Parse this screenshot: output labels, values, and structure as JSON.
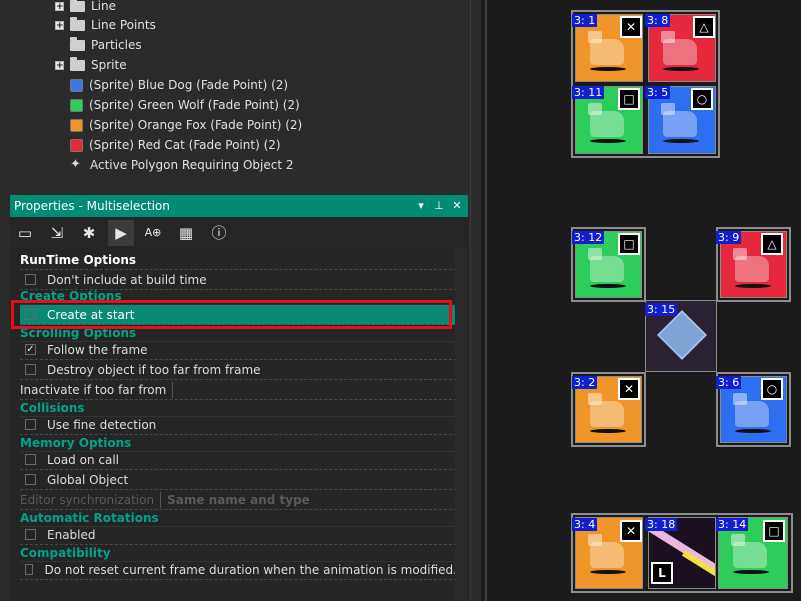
{
  "tree": {
    "items": [
      {
        "label": "Line",
        "type": "folder",
        "expandable": true
      },
      {
        "label": "Line Points",
        "type": "folder",
        "expandable": true
      },
      {
        "label": "Particles",
        "type": "folder",
        "expandable": false
      },
      {
        "label": "Sprite",
        "type": "folder",
        "expandable": true
      },
      {
        "label": "(Sprite) Blue Dog (Fade Point) (2)",
        "type": "sprite",
        "color": "#3a78e8"
      },
      {
        "label": "(Sprite) Green Wolf (Fade Point) (2)",
        "type": "sprite",
        "color": "#2ecc5a"
      },
      {
        "label": "(Sprite) Orange Fox (Fade Point) (2)",
        "type": "sprite",
        "color": "#f0952a"
      },
      {
        "label": "(Sprite) Red Cat (Fade Point) (2)",
        "type": "sprite",
        "color": "#e5283c"
      },
      {
        "label": "Active Polygon Requiring Object 2",
        "type": "polygon"
      }
    ]
  },
  "panel": {
    "title": "Properties - Multiselection",
    "controls": {
      "menu": "▾",
      "pin": "⊥",
      "close": "✕"
    },
    "toolbar_icons": [
      "display-icon",
      "move-icon",
      "actor-icon",
      "runtime-icon",
      "text-icon",
      "grid-icon",
      "info-icon"
    ]
  },
  "properties": {
    "heading": "RunTime Options",
    "dont_include": "Don't include at build time",
    "create_options": "Create Options",
    "create_at_start": "Create at start",
    "scrolling_options": "Scrolling Options",
    "follow_frame": "Follow the frame",
    "destroy_far": "Destroy object if too far from frame",
    "inactivate_far": "Inactivate if too far from",
    "collisions": "Collisions",
    "fine_detection": "Use fine detection",
    "memory_options": "Memory Options",
    "load_on_call": "Load on call",
    "global_object": "Global Object",
    "editor_sync": "Editor synchronization",
    "editor_sync_value": "Same name and type",
    "auto_rotations": "Automatic Rotations",
    "enabled": "Enabled",
    "compatibility": "Compatibility",
    "dont_reset": "Do not reset current frame duration when the animation is modified."
  },
  "canvas": {
    "objects": [
      {
        "id": "3: 1",
        "color": "orange",
        "badge": "✕"
      },
      {
        "id": "3: 8",
        "color": "red",
        "badge": "△"
      },
      {
        "id": "3: 11",
        "color": "green",
        "badge": "□"
      },
      {
        "id": "3: 5",
        "color": "blue",
        "badge": "○"
      },
      {
        "id": "3: 12",
        "color": "green",
        "badge": "□"
      },
      {
        "id": "3: 9",
        "color": "red",
        "badge": "△"
      },
      {
        "id": "3: 15",
        "color": "gem",
        "badge": ""
      },
      {
        "id": "3: 2",
        "color": "orange",
        "badge": "✕"
      },
      {
        "id": "3: 6",
        "color": "blue",
        "badge": "○"
      },
      {
        "id": "3: 4",
        "color": "orange",
        "badge": "✕"
      },
      {
        "id": "3: 18",
        "color": "beam",
        "badge": "L"
      },
      {
        "id": "3: 14",
        "color": "green",
        "badge": "□"
      }
    ]
  }
}
